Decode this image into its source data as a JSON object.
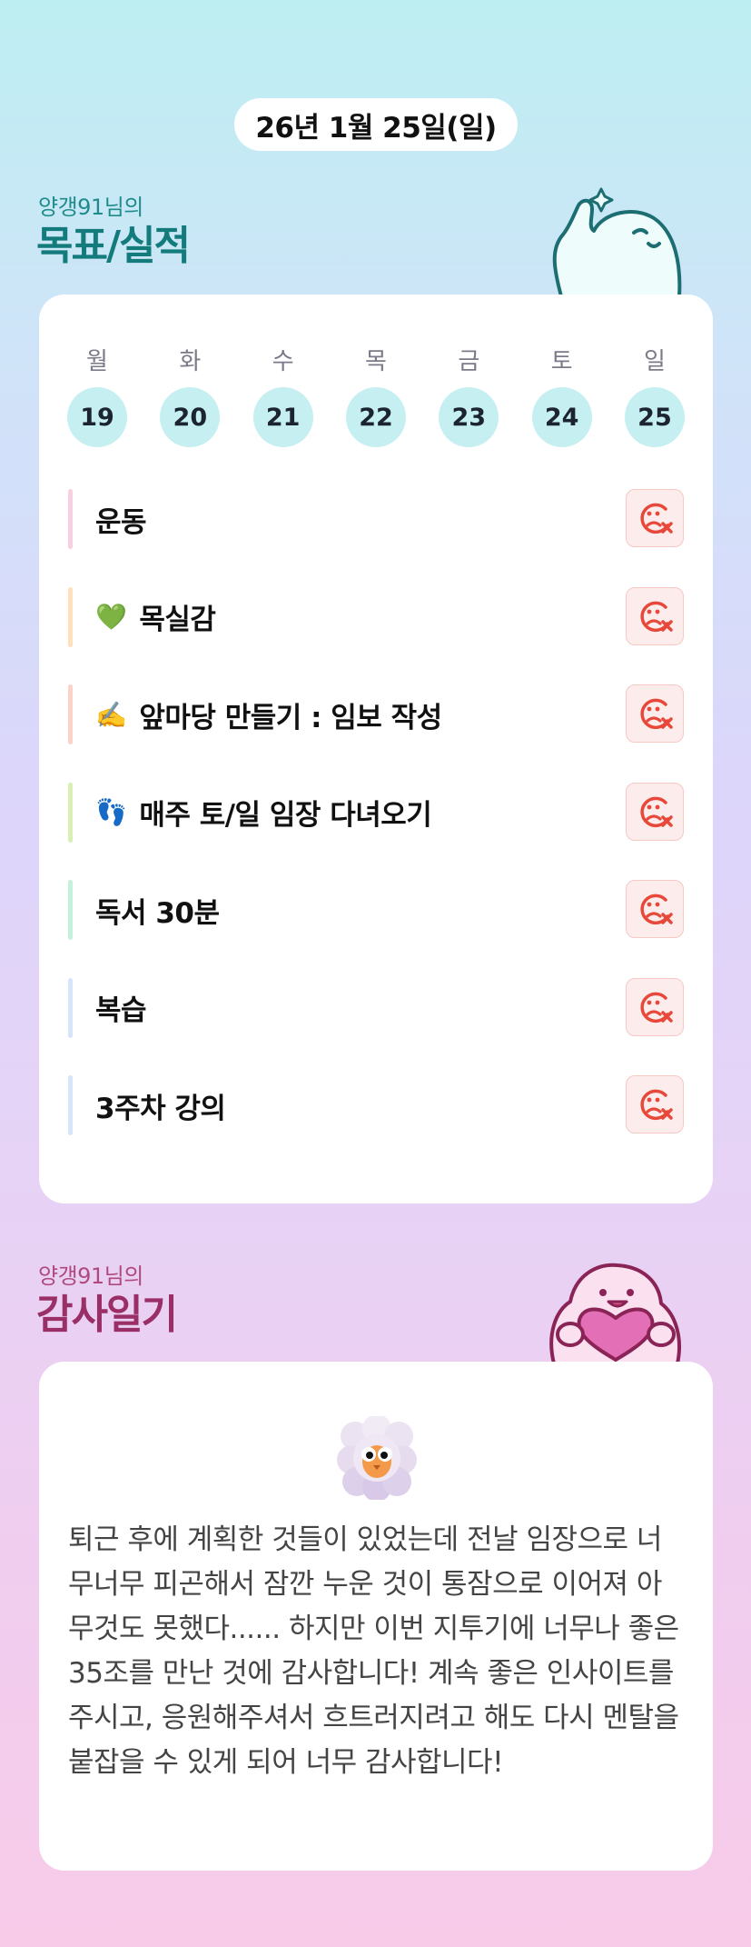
{
  "header": {
    "date": "26년 1월 25일(일)"
  },
  "goals_section": {
    "subtitle": "양갱91님의",
    "title": "목표/실적",
    "mascot_icon": "waving-character-icon",
    "week": [
      {
        "weekday": "월",
        "date": "19"
      },
      {
        "weekday": "화",
        "date": "20"
      },
      {
        "weekday": "수",
        "date": "21"
      },
      {
        "weekday": "목",
        "date": "22"
      },
      {
        "weekday": "금",
        "date": "23"
      },
      {
        "weekday": "토",
        "date": "24"
      },
      {
        "weekday": "일",
        "date": "25"
      }
    ],
    "goals": [
      {
        "emoji": "",
        "label": "운동",
        "bar_color": "#f9cfe2",
        "status_icon": "sad-face-x-icon"
      },
      {
        "emoji": "💚",
        "label": "목실감",
        "bar_color": "#ffe0bc",
        "status_icon": "sad-face-x-icon"
      },
      {
        "emoji": "✍️",
        "label": "앞마당 만들기 : 임보 작성",
        "bar_color": "#fbd3c8",
        "status_icon": "sad-face-x-icon"
      },
      {
        "emoji": "👣",
        "label": "매주 토/일 임장 다녀오기",
        "bar_color": "#d9f0b4",
        "status_icon": "sad-face-x-icon"
      },
      {
        "emoji": "",
        "label": "독서 30분",
        "bar_color": "#c4f0de",
        "status_icon": "sad-face-x-icon"
      },
      {
        "emoji": "",
        "label": "복습",
        "bar_color": "#d6e6fa",
        "status_icon": "sad-face-x-icon"
      },
      {
        "emoji": "",
        "label": "3주차 강의",
        "bar_color": "#d6e6fa",
        "status_icon": "sad-face-x-icon"
      }
    ]
  },
  "gratitude_section": {
    "subtitle": "양갱91님의",
    "title": "감사일기",
    "mascot_icon": "heart-hugging-character-icon",
    "entry_icon": "fluffy-cloud-owl-icon",
    "text": "퇴근 후에 계획한 것들이 있었는데 전날 임장으로 너무너무 피곤해서 잠깐 누운 것이 통잠으로 이어져 아무것도 못했다...... 하지만 이번 지투기에 너무나 좋은 35조를 만난 것에 감사합니다! 계속 좋은 인사이트를 주시고, 응원해주셔서 흐트러지려고 해도 다시 멘탈을 붙잡을 수 있게 되어 너무 감사합니다!"
  },
  "colors": {
    "teal_title": "#137b7b",
    "pink_title": "#9a2e66",
    "day_circle": "#c6eff1",
    "fail_icon": "#e8483a"
  }
}
